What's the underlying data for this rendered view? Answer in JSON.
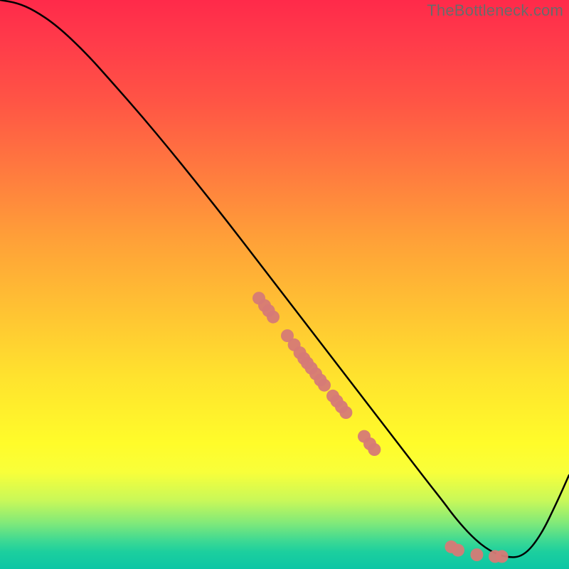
{
  "attribution": "TheBottleneck.com",
  "colors": {
    "curve_stroke": "#000000",
    "point_fill": "#d67a76",
    "point_stroke": "#d67a76",
    "attribution_text": "#6a6a6a"
  },
  "chart_data": {
    "type": "line",
    "title": "",
    "xlabel": "",
    "ylabel": "",
    "xlim": [
      0,
      100
    ],
    "ylim": [
      0,
      100
    ],
    "grid": false,
    "legend": false,
    "series": [
      {
        "name": "bottleneck-curve",
        "notes": "Approximate curve: high on left, descends roughly linearly, flattens near x≈80–92, then rises steeply toward right edge. Percentages are relative to plot area (0–100).",
        "x": [
          0,
          3,
          6,
          10,
          15,
          20,
          25,
          30,
          35,
          40,
          45,
          50,
          55,
          60,
          65,
          70,
          75,
          78,
          80,
          83,
          86,
          89,
          92,
          95,
          98,
          100
        ],
        "y": [
          100,
          99.5,
          98.2,
          95.5,
          90.8,
          85.2,
          79.5,
          73.5,
          67.3,
          61.0,
          54.5,
          48.0,
          41.5,
          35.0,
          28.5,
          22.0,
          15.5,
          11.7,
          9.0,
          5.6,
          3.2,
          2.0,
          2.2,
          5.8,
          12.0,
          16.5
        ]
      }
    ],
    "points": [
      {
        "name": "cluster-upper",
        "x": 45.5,
        "y": 47.6
      },
      {
        "name": "cluster-upper",
        "x": 46.5,
        "y": 46.3
      },
      {
        "name": "cluster-upper",
        "x": 47.2,
        "y": 45.4
      },
      {
        "name": "cluster-upper",
        "x": 48.0,
        "y": 44.3
      },
      {
        "name": "cluster-upper",
        "x": 50.5,
        "y": 41.0
      },
      {
        "name": "cluster-upper",
        "x": 51.7,
        "y": 39.4
      },
      {
        "name": "cluster-upper",
        "x": 52.7,
        "y": 38.0
      },
      {
        "name": "cluster-upper",
        "x": 53.4,
        "y": 37.0
      },
      {
        "name": "cluster-upper",
        "x": 54.0,
        "y": 36.2
      },
      {
        "name": "cluster-upper",
        "x": 54.7,
        "y": 35.3
      },
      {
        "name": "cluster-upper",
        "x": 55.5,
        "y": 34.3
      },
      {
        "name": "cluster-upper",
        "x": 56.3,
        "y": 33.2
      },
      {
        "name": "cluster-upper",
        "x": 57.0,
        "y": 32.3
      },
      {
        "name": "cluster-upper",
        "x": 58.5,
        "y": 30.4
      },
      {
        "name": "cluster-upper",
        "x": 59.2,
        "y": 29.5
      },
      {
        "name": "cluster-upper",
        "x": 60.0,
        "y": 28.5
      },
      {
        "name": "cluster-upper",
        "x": 60.8,
        "y": 27.5
      },
      {
        "name": "cluster-lower",
        "x": 64.0,
        "y": 23.3
      },
      {
        "name": "cluster-lower",
        "x": 65.0,
        "y": 22.0
      },
      {
        "name": "cluster-lower",
        "x": 65.8,
        "y": 21.0
      },
      {
        "name": "cluster-valley",
        "x": 79.3,
        "y": 3.9
      },
      {
        "name": "cluster-valley",
        "x": 80.5,
        "y": 3.3
      },
      {
        "name": "cluster-valley",
        "x": 83.8,
        "y": 2.5
      },
      {
        "name": "cluster-valley",
        "x": 87.0,
        "y": 2.2
      },
      {
        "name": "cluster-valley",
        "x": 88.2,
        "y": 2.2
      }
    ]
  }
}
